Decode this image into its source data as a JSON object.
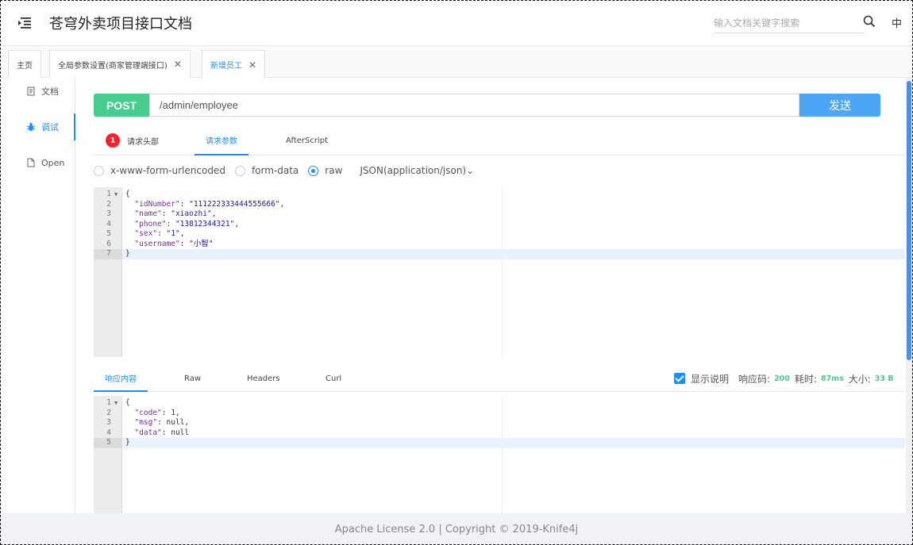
{
  "header": {
    "title": "苍穹外卖项目接口文档",
    "search_placeholder": "输入文档关键字搜索",
    "lang": "中"
  },
  "tabs": [
    {
      "label": "主页",
      "closable": false,
      "active": false
    },
    {
      "label": "全局参数设置(商家管理端接口)",
      "closable": true,
      "active": false
    },
    {
      "label": "新增员工",
      "closable": true,
      "active": true
    }
  ],
  "sidebar": {
    "items": [
      {
        "label": "文档",
        "icon": "document-icon",
        "active": false
      },
      {
        "label": "调试",
        "icon": "bug-icon",
        "active": true
      },
      {
        "label": "Open",
        "icon": "file-icon",
        "active": false
      }
    ]
  },
  "request": {
    "method": "POST",
    "url": "/admin/employee",
    "send_label": "发送",
    "tabs": [
      {
        "label": "请求头部",
        "badge": "1",
        "active": false
      },
      {
        "label": "请求参数",
        "active": true
      },
      {
        "label": "AfterScript",
        "active": false
      }
    ],
    "body_types": [
      {
        "label": "x-www-form-urlencoded",
        "checked": false
      },
      {
        "label": "form-data",
        "checked": false
      },
      {
        "label": "raw",
        "checked": true
      }
    ],
    "content_type": "JSON(application/json)",
    "body_lines": [
      "{",
      "  \"idNumber\": \"111222333444555666\",",
      "  \"name\": \"xiaozhi\",",
      "  \"phone\": \"13812344321\",",
      "  \"sex\": \"1\",",
      "  \"username\": \"小智\"",
      "}"
    ]
  },
  "response": {
    "tabs": [
      {
        "label": "响应内容",
        "active": true
      },
      {
        "label": "Raw",
        "active": false
      },
      {
        "label": "Headers",
        "active": false
      },
      {
        "label": "Curl",
        "active": false
      }
    ],
    "show_desc_label": "显示说明",
    "code_label": "响应码:",
    "code_value": "200",
    "time_label": "耗时:",
    "time_value": "87ms",
    "size_label": "大小:",
    "size_value": "33 B",
    "body_lines": [
      "{",
      "  \"code\": 1,",
      "  \"msg\": null,",
      "  \"data\": null",
      "}"
    ]
  },
  "footer": {
    "text": "Apache License 2.0 | Copyright © 2019-Knife4j"
  },
  "colors": {
    "method_post": "#49cc90",
    "primary": "#1890ff",
    "send_button": "#4da6f5",
    "badge": "#f5222d"
  }
}
